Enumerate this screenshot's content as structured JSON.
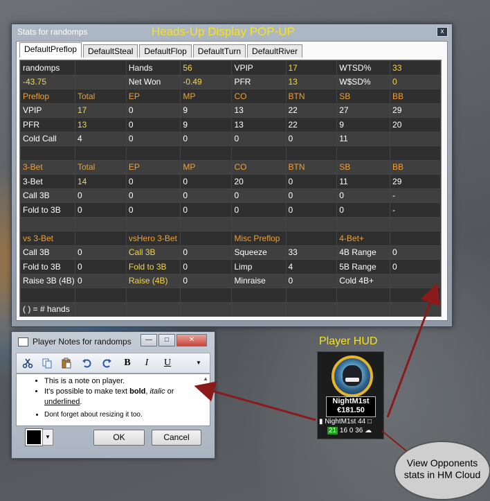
{
  "stats_window": {
    "title": "Stats for randomps",
    "heading": "Heads-Up Display POP-UP",
    "close": "x",
    "tabs": [
      "DefaultPreflop",
      "DefaultSteal",
      "DefaultFlop",
      "DefaultTurn",
      "DefaultRiver"
    ],
    "rows": [
      [
        [
          "randomps",
          ""
        ],
        [
          "",
          ""
        ],
        [
          "Hands",
          ""
        ],
        [
          "56",
          "y"
        ],
        [
          "VPIP",
          ""
        ],
        [
          "17",
          "y"
        ],
        [
          "WTSD%",
          ""
        ],
        [
          "33",
          "y"
        ]
      ],
      [
        [
          "-43.75",
          "y"
        ],
        [
          "",
          ""
        ],
        [
          "Net Won",
          ""
        ],
        [
          "-0.49",
          "y"
        ],
        [
          "PFR",
          ""
        ],
        [
          "13",
          "y"
        ],
        [
          "W$SD%",
          ""
        ],
        [
          "0",
          "y"
        ]
      ],
      [
        [
          "Preflop",
          "o"
        ],
        [
          "Total",
          "o"
        ],
        [
          "EP",
          "o"
        ],
        [
          "MP",
          "o"
        ],
        [
          "CO",
          "o"
        ],
        [
          "BTN",
          "o"
        ],
        [
          "SB",
          "o"
        ],
        [
          "BB",
          "o"
        ]
      ],
      [
        [
          "VPIP",
          ""
        ],
        [
          "17",
          "y"
        ],
        [
          "0",
          ""
        ],
        [
          "9",
          ""
        ],
        [
          "13",
          ""
        ],
        [
          "22",
          ""
        ],
        [
          "27",
          ""
        ],
        [
          "29",
          ""
        ]
      ],
      [
        [
          "PFR",
          ""
        ],
        [
          "13",
          "y"
        ],
        [
          "0",
          ""
        ],
        [
          "9",
          ""
        ],
        [
          "13",
          ""
        ],
        [
          "22",
          ""
        ],
        [
          "9",
          ""
        ],
        [
          "20",
          ""
        ]
      ],
      [
        [
          "Cold Call",
          ""
        ],
        [
          "4",
          ""
        ],
        [
          "0",
          ""
        ],
        [
          "0",
          ""
        ],
        [
          "0",
          ""
        ],
        [
          "0",
          ""
        ],
        [
          "11",
          ""
        ],
        [
          "",
          ""
        ]
      ],
      [
        [
          "",
          ""
        ],
        [
          "",
          ""
        ],
        [
          "",
          ""
        ],
        [
          "",
          ""
        ],
        [
          "",
          ""
        ],
        [
          "",
          ""
        ],
        [
          "",
          ""
        ],
        [
          "",
          ""
        ]
      ],
      [
        [
          "3-Bet",
          "o"
        ],
        [
          "Total",
          "o"
        ],
        [
          "EP",
          "o"
        ],
        [
          "MP",
          "o"
        ],
        [
          "CO",
          "o"
        ],
        [
          "BTN",
          "o"
        ],
        [
          "SB",
          "o"
        ],
        [
          "BB",
          "o"
        ]
      ],
      [
        [
          "3-Bet",
          ""
        ],
        [
          "14",
          "y"
        ],
        [
          "0",
          ""
        ],
        [
          "0",
          ""
        ],
        [
          "20",
          ""
        ],
        [
          "0",
          ""
        ],
        [
          "11",
          ""
        ],
        [
          "29",
          ""
        ]
      ],
      [
        [
          "Call 3B",
          ""
        ],
        [
          "0",
          ""
        ],
        [
          "0",
          ""
        ],
        [
          "0",
          ""
        ],
        [
          "0",
          ""
        ],
        [
          "0",
          ""
        ],
        [
          "0",
          ""
        ],
        [
          "-",
          ""
        ]
      ],
      [
        [
          "Fold to 3B",
          ""
        ],
        [
          "0",
          ""
        ],
        [
          "0",
          ""
        ],
        [
          "0",
          ""
        ],
        [
          "0",
          ""
        ],
        [
          "0",
          ""
        ],
        [
          "0",
          ""
        ],
        [
          "-",
          ""
        ]
      ],
      [
        [
          "",
          ""
        ],
        [
          "",
          ""
        ],
        [
          "",
          ""
        ],
        [
          "",
          ""
        ],
        [
          "",
          ""
        ],
        [
          "",
          ""
        ],
        [
          "",
          ""
        ],
        [
          "",
          ""
        ]
      ],
      [
        [
          "vs 3-Bet",
          "o"
        ],
        [
          "",
          ""
        ],
        [
          "vsHero 3-Bet",
          "o"
        ],
        [
          "",
          ""
        ],
        [
          "Misc Preflop",
          "o"
        ],
        [
          "",
          ""
        ],
        [
          "4-Bet+",
          "o"
        ],
        [
          "",
          ""
        ]
      ],
      [
        [
          "Call 3B",
          ""
        ],
        [
          "0",
          ""
        ],
        [
          "Call 3B",
          "y"
        ],
        [
          "0",
          ""
        ],
        [
          "Squeeze",
          ""
        ],
        [
          "33",
          ""
        ],
        [
          "4B Range",
          ""
        ],
        [
          "0",
          ""
        ]
      ],
      [
        [
          "Fold to 3B",
          ""
        ],
        [
          "0",
          ""
        ],
        [
          "Fold to 3B",
          "y"
        ],
        [
          "0",
          ""
        ],
        [
          "Limp",
          ""
        ],
        [
          "4",
          ""
        ],
        [
          "5B Range",
          ""
        ],
        [
          "0",
          ""
        ]
      ],
      [
        [
          "Raise 3B (4B)",
          ""
        ],
        [
          "0",
          ""
        ],
        [
          "Raise (4B)",
          "y"
        ],
        [
          "0",
          ""
        ],
        [
          "Minraise",
          ""
        ],
        [
          "0",
          ""
        ],
        [
          "Cold 4B+",
          ""
        ],
        [
          "",
          ""
        ]
      ],
      [
        [
          "",
          ""
        ],
        [
          "",
          ""
        ],
        [
          "",
          ""
        ],
        [
          "",
          ""
        ],
        [
          "",
          ""
        ],
        [
          "",
          ""
        ],
        [
          "",
          ""
        ],
        [
          "",
          ""
        ]
      ],
      [
        [
          "( ) = # hands",
          ""
        ],
        [
          "",
          ""
        ],
        [
          "",
          ""
        ],
        [
          "",
          ""
        ],
        [
          "",
          ""
        ],
        [
          "",
          ""
        ],
        [
          "",
          ""
        ],
        [
          "",
          ""
        ]
      ]
    ]
  },
  "notes_window": {
    "title": "Player Notes for randomps",
    "toolbar": {
      "bold": "B",
      "italic": "I",
      "underline": "U"
    },
    "notes": {
      "line1": "This is a note on player.",
      "line2_a": "It's possible to make text ",
      "line2_bold": "bold",
      "line2_sep": ", ",
      "line2_italic": "italic",
      "line2_or": " or",
      "line2_underline": "underlined",
      "line2_end": ".",
      "line3": "Dont forget about resizing it too."
    },
    "ok_label": "OK",
    "cancel_label": "Cancel",
    "text_color": "#000000"
  },
  "player_hud": {
    "label": "Player HUD",
    "name": "NightM1st",
    "stack": "€181.50",
    "line1_name": "NightM1st",
    "line1_count": "44",
    "stat_green": "21",
    "stat_rest": "16   0 36"
  },
  "cloud_callout": {
    "line1": "View Opponents",
    "line2": "stats in HM Cloud"
  }
}
